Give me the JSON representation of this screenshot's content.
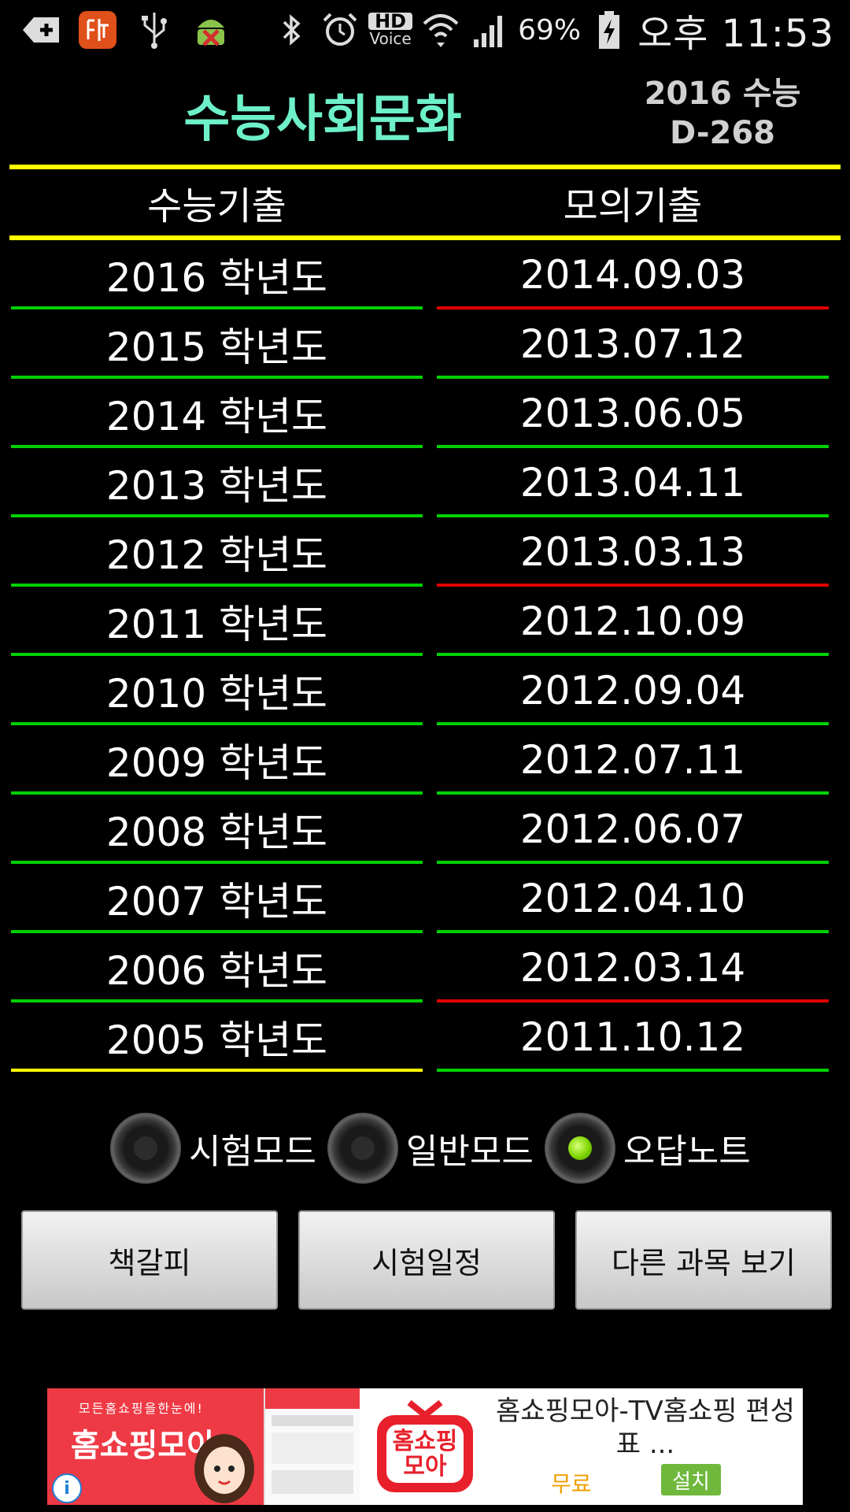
{
  "status_bar": {
    "icons_left": [
      "add-app-icon",
      "shrimp-app-icon",
      "usb-icon",
      "android-debug-icon"
    ],
    "icons_right": [
      "bluetooth-icon",
      "alarm-icon",
      "hd-voice-icon",
      "wifi-icon",
      "signal-icon",
      "charging-battery-icon"
    ],
    "hd_label": "HD",
    "voice_label": "Voice",
    "battery": "69%",
    "time": "오후 11:53"
  },
  "header": {
    "title": "수능사회문화",
    "dday_line1": "2016 수능",
    "dday_line2": "D-268"
  },
  "columns": {
    "left_header": "수능기출",
    "right_header": "모의기출"
  },
  "suneung_list": [
    {
      "label": "2016 학년도",
      "line": "#00d000"
    },
    {
      "label": "2015 학년도",
      "line": "#00d000"
    },
    {
      "label": "2014 학년도",
      "line": "#00d000"
    },
    {
      "label": "2013 학년도",
      "line": "#00d000"
    },
    {
      "label": "2012 학년도",
      "line": "#00d000"
    },
    {
      "label": "2011 학년도",
      "line": "#00d000"
    },
    {
      "label": "2010 학년도",
      "line": "#00d000"
    },
    {
      "label": "2009 학년도",
      "line": "#00d000"
    },
    {
      "label": "2008 학년도",
      "line": "#00d000"
    },
    {
      "label": "2007 학년도",
      "line": "#00d000"
    },
    {
      "label": "2006 학년도",
      "line": "#00d000"
    },
    {
      "label": "2005 학년도",
      "line": "#ffff00"
    }
  ],
  "mock_list": [
    {
      "label": "2014.09.03",
      "line": "#e00000"
    },
    {
      "label": "2013.07.12",
      "line": "#00d000"
    },
    {
      "label": "2013.06.05",
      "line": "#00d000"
    },
    {
      "label": "2013.04.11",
      "line": "#00d000"
    },
    {
      "label": "2013.03.13",
      "line": "#e00000"
    },
    {
      "label": "2012.10.09",
      "line": "#00d000"
    },
    {
      "label": "2012.09.04",
      "line": "#00d000"
    },
    {
      "label": "2012.07.11",
      "line": "#00d000"
    },
    {
      "label": "2012.06.07",
      "line": "#00d000"
    },
    {
      "label": "2012.04.10",
      "line": "#00d000"
    },
    {
      "label": "2012.03.14",
      "line": "#e00000"
    },
    {
      "label": "2011.10.12",
      "line": "#00d000"
    }
  ],
  "modes": [
    {
      "label": "시험모드",
      "selected": false
    },
    {
      "label": "일반모드",
      "selected": false
    },
    {
      "label": "오답노트",
      "selected": true
    }
  ],
  "buttons": {
    "bookmark": "책갈피",
    "schedule": "시험일정",
    "other_subjects": "다른 과목 보기"
  },
  "ad": {
    "tagline": "모든홈쇼핑을한눈에!",
    "brand": "홈쇼핑모아",
    "logo_line1": "홈쇼핑",
    "logo_line2": "모아",
    "title": "홈쇼핑모아-TV홈쇼핑 편성표 ...",
    "price": "무료",
    "install": "설치",
    "info": "i"
  },
  "colors": {
    "title": "#6ef0c8",
    "divider_yellow": "#ffff00",
    "row_green": "#00d000",
    "row_red": "#e00000",
    "ad_red": "#ee3a45"
  }
}
